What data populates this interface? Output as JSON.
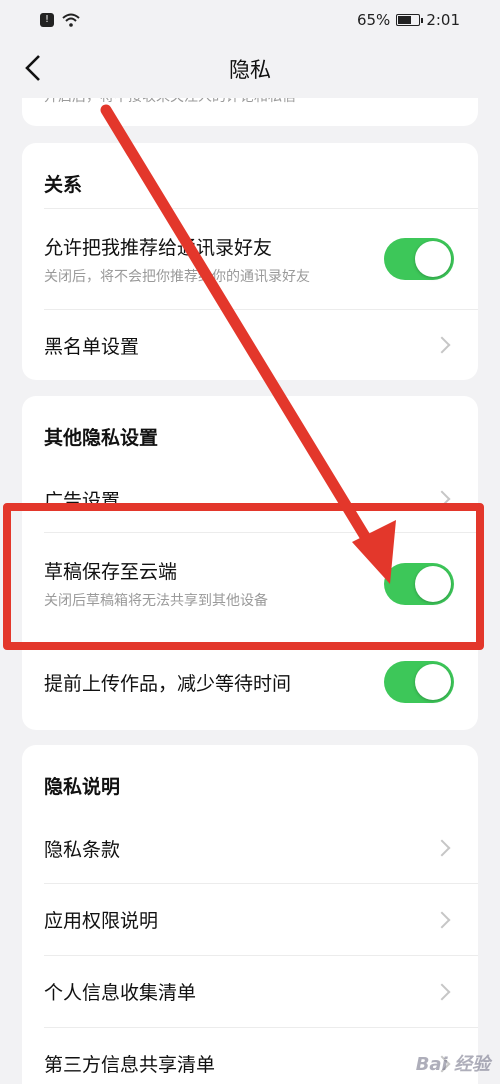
{
  "status_bar": {
    "battery": "65%",
    "battery_level": 0.65,
    "time": "2:01"
  },
  "nav": {
    "title": "隐私"
  },
  "top_card": {
    "clipped_text": "开启后，将不接收未关注人的评论和私信"
  },
  "relations": {
    "title": "关系",
    "recommend": {
      "label": "允许把我推荐给通讯录好友",
      "sub": "关闭后，将不会把你推荐给你的通讯录好友",
      "on": true
    },
    "blacklist": {
      "label": "黑名单设置"
    }
  },
  "other_privacy": {
    "title": "其他隐私设置",
    "ads": {
      "label": "广告设置"
    },
    "draft_cloud": {
      "label": "草稿保存至云端",
      "sub": "关闭后草稿箱将无法共享到其他设备",
      "on": true
    },
    "pre_upload": {
      "label": "提前上传作品，减少等待时间",
      "on": true
    }
  },
  "privacy_info": {
    "title": "隐私说明",
    "items": [
      {
        "label": "隐私条款"
      },
      {
        "label": "应用权限说明"
      },
      {
        "label": "个人信息收集清单"
      },
      {
        "label": "第三方信息共享清单"
      }
    ]
  },
  "annotation": {
    "color": "#e3372b"
  },
  "watermark": {
    "text": "Bai 经验"
  },
  "colors": {
    "toggle_on": "#3dc759",
    "background": "#f2f2f4"
  }
}
